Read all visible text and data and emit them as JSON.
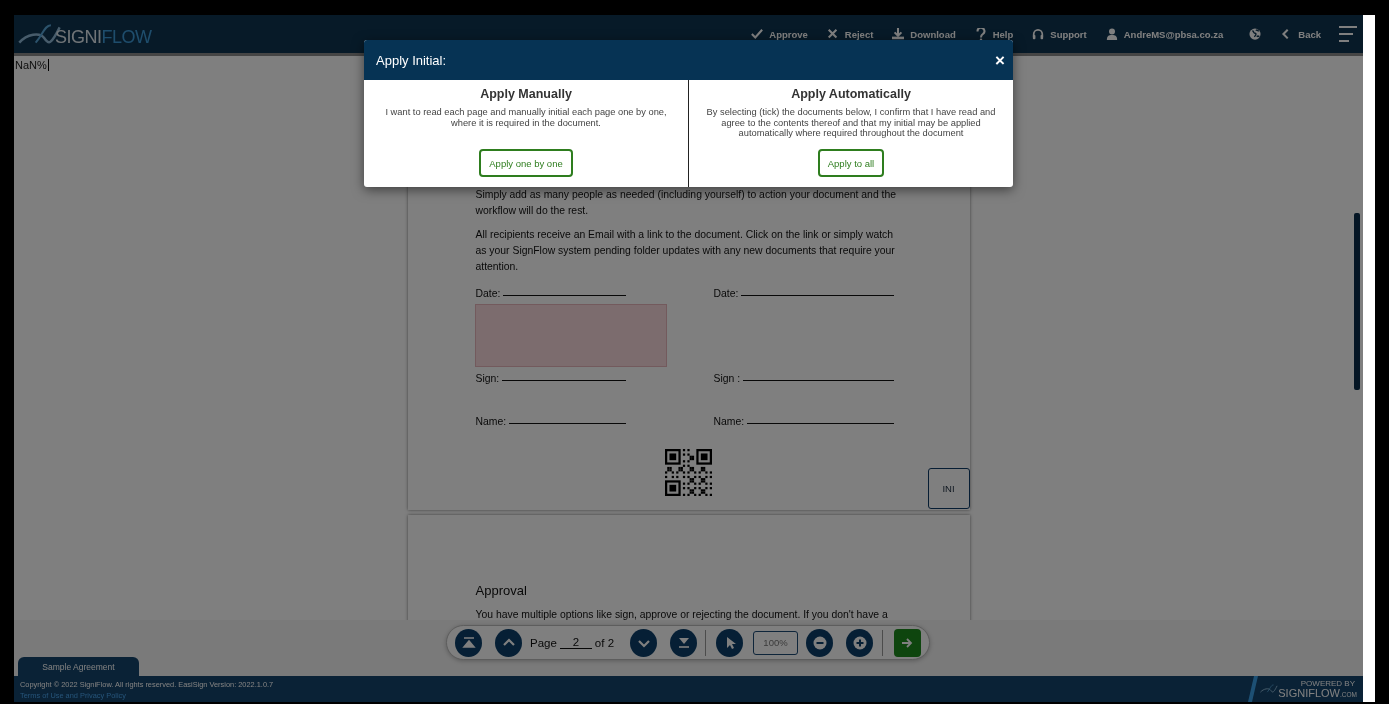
{
  "header": {
    "logo": {
      "part_1": "SIGNI",
      "part_2": "FLOW"
    },
    "actions": [
      {
        "kind": "approve",
        "label": "Approve"
      },
      {
        "kind": "reject",
        "label": "Reject"
      },
      {
        "kind": "download",
        "label": "Download"
      },
      {
        "kind": "help",
        "label": "Help"
      },
      {
        "kind": "support",
        "label": "Support"
      },
      {
        "kind": "user",
        "label": "AndreMS@pbsa.co.za"
      },
      {
        "kind": "language"
      },
      {
        "kind": "back",
        "label": "Back"
      },
      {
        "kind": "menu"
      }
    ]
  },
  "zoom_readout": "NaN%",
  "document": {
    "pages": [
      {
        "paragraphs": [
          "Simply add as many people as needed (including yourself) to action your document and the workflow will do the rest.",
          "All recipients receive an Email with a link to the document. Click on the link or simply watch as your SignFlow system pending folder updates with any new documents that require your attention."
        ],
        "fields_left": [
          "Date:",
          "Sign:",
          "Name:"
        ],
        "fields_right": [
          "Date:",
          "Sign :",
          "Name:"
        ],
        "initial_box": "INI"
      },
      {
        "heading": "Approval",
        "paragraphs": [
          "You have multiple options like sign, approve or rejecting the document. If you don't have a"
        ]
      }
    ]
  },
  "toolbar": {
    "page_label": "Page",
    "page_value": "2",
    "page_total": "of 2",
    "zoom_value": "100%"
  },
  "document_tab": "Sample Agreement",
  "footer": {
    "copyright": "Copyright © 2022 SigniFlow. All rights reserved. EasiSign Version: 2022.1.0.7",
    "link": "Terms of Use and Privacy Policy",
    "badge": {
      "caption": "POWERED BY",
      "part_1": "SIGNI",
      "part_2": "FLOW",
      "suffix": ".COM"
    }
  },
  "modal": {
    "title": "Apply Initial:",
    "close": "×",
    "options": [
      {
        "heading": "Apply Manually",
        "text": "I want to read each page and manually initial each page one by one, where it is required in the document.",
        "button": "Apply one by one"
      },
      {
        "heading": "Apply Automatically",
        "text": "By selecting (tick) the documents below, I confirm that I have read and agree to the contents thereof and that my initial may be applied automatically where required throughout the document",
        "button": "Apply to all"
      }
    ]
  }
}
